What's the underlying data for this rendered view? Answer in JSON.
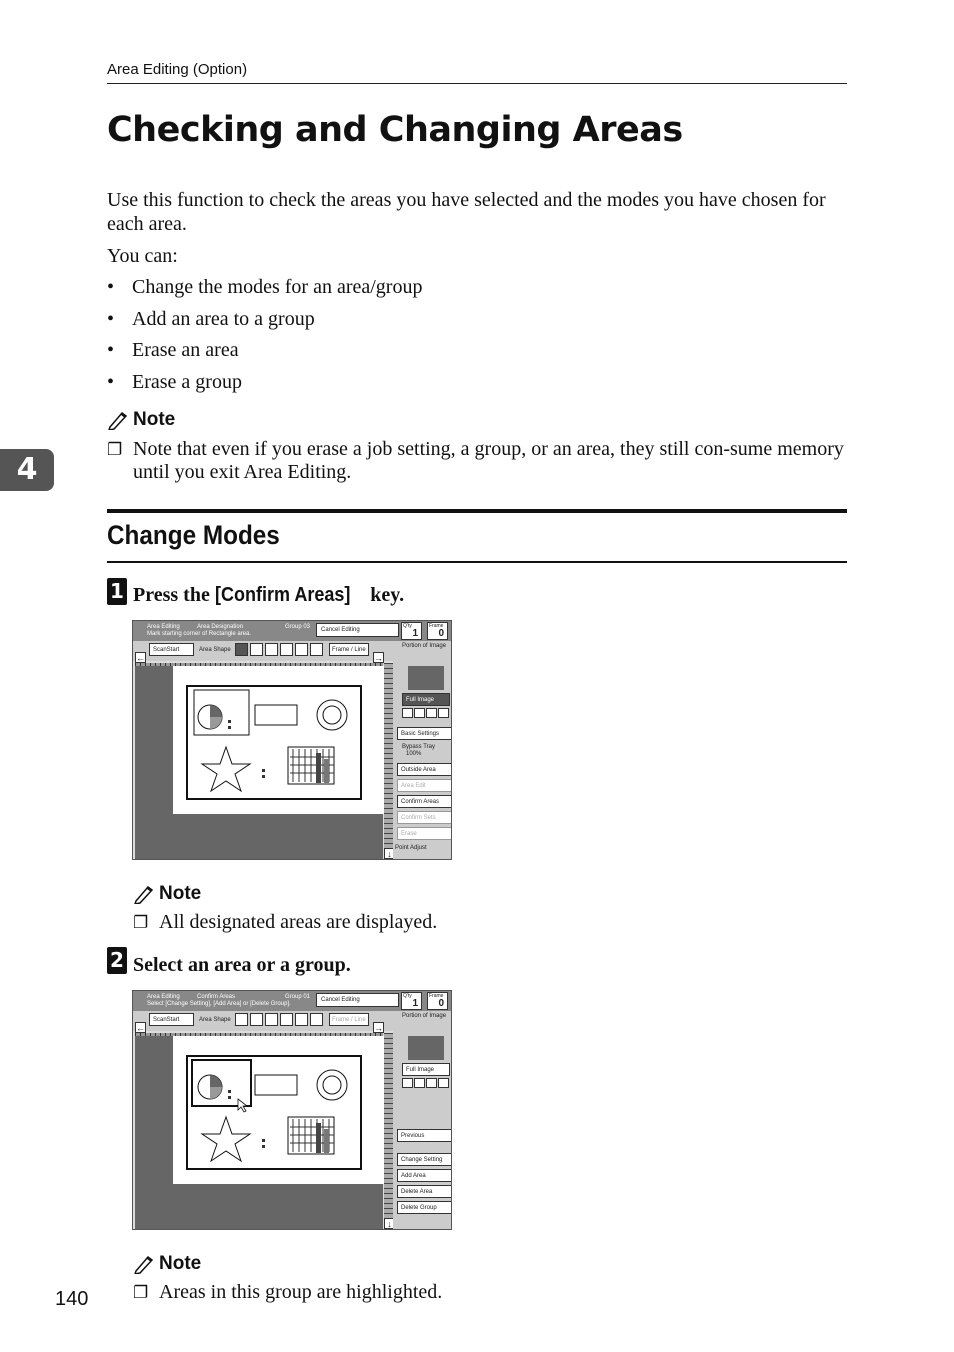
{
  "header": {
    "running_title": "Area Editing (Option)"
  },
  "title": "Checking and Changing Areas",
  "intro": "Use this function to check the areas you have selected and the modes you have chosen for each area.",
  "you_can": "You can:",
  "bullets": [
    "Change the modes for an area/group",
    "Add an area to a group",
    "Erase an area",
    "Erase a group"
  ],
  "note_label": "Note",
  "note1": "Note that even if you erase a job setting, a group, or an area, they still con-sume memory until you exit Area Editing.",
  "chapter_tab": "4",
  "section_title": "Change Modes",
  "step1": {
    "num": "1",
    "pre": "Press the ",
    "key": "[Confirm Areas]",
    "post": " key."
  },
  "note2": "All designated areas are displayed.",
  "step2": {
    "num": "2",
    "text": "Select an area or a group."
  },
  "note3": "Areas in this group are highlighted.",
  "page_number": "140",
  "checkbox_glyph": "❐",
  "bullet_glyph": "•",
  "screen1": {
    "title1": "Area Editing",
    "title2": "Area Designation",
    "group": "Group 03",
    "line2": "Mark starting corner of Rectangle area.",
    "cancel": "Cancel Editing",
    "copy_label": "Q'ty",
    "copy_value": "1",
    "frame_label": "Frame",
    "frame_value": "0",
    "scan": "ScanStart",
    "area_shape": "Area Shape",
    "frame_line": "Frame / Line",
    "portion": "Portion of Image",
    "full_image": "Full Image",
    "basic": "Basic Settings",
    "bypass": "Bypass Tray",
    "bypass_pct": "100%",
    "outside": "Outside Area",
    "area_edit": "Area Edit",
    "confirm": "Confirm Areas",
    "confirm_sets": "Confirm Sets",
    "erase": "Erase",
    "point_adjust": "Point Adjust"
  },
  "screen2": {
    "title1": "Area Editing",
    "title2": "Confirm Areas",
    "group": "Group 01",
    "line2": "Select [Change Setting], [Add Area] or [Delete Group].",
    "cancel": "Cancel Editing",
    "copy_label": "Q'ty",
    "copy_value": "1",
    "frame_label": "Frame",
    "frame_value": "0",
    "scan": "ScanStart",
    "area_shape": "Area Shape",
    "frame_line": "Frame / Line",
    "portion": "Portion of Image",
    "full_image": "Full Image",
    "previous": "Previous",
    "change": "Change Setting",
    "add": "Add Area",
    "delete_area": "Delete Area",
    "delete_group": "Delete Group"
  }
}
